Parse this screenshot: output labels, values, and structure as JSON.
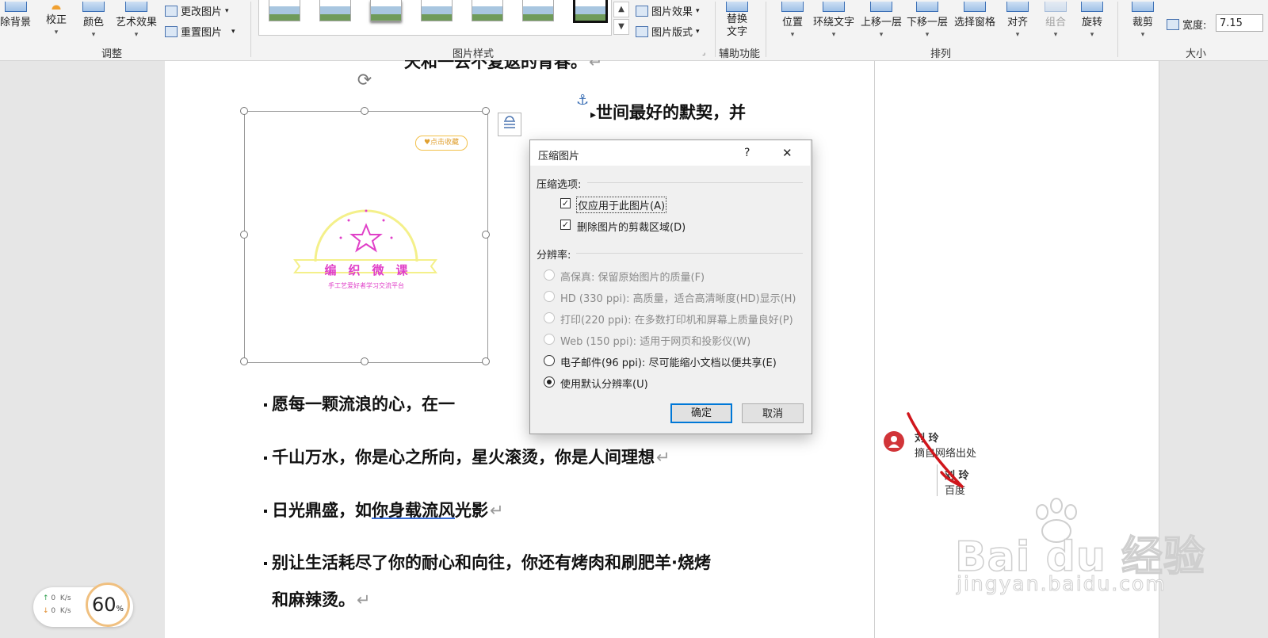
{
  "ribbon": {
    "remove_bg": "除背景",
    "corrections": "校正",
    "color": "颜色",
    "art_effects": "艺术效果",
    "change_picture": "更改图片",
    "reset_picture": "重置图片",
    "group_adjust": "调整",
    "picture_effects": "图片效果",
    "picture_layout": "图片版式",
    "group_styles": "图片样式",
    "alt_text_line1": "替换",
    "alt_text_line2": "文字",
    "group_accessibility": "辅助功能",
    "position": "位置",
    "wrap_text": "环绕文字",
    "bring_forward": "上移一层",
    "send_backward": "下移一层",
    "selection_pane": "选择窗格",
    "align": "对齐",
    "group": "组合",
    "rotate": "旋转",
    "group_arrange": "排列",
    "crop": "裁剪",
    "width_label": "宽度:",
    "width_value": "7.15",
    "group_size": "大小"
  },
  "document": {
    "top_line": "天和一去不复返的青春。",
    "anchored_line": "世间最好的默契，并",
    "lines": [
      "愿每一颗流浪的心，在一",
      "千山万水，你是心之所向，星火滚烫，你是人间理想",
      "日光鼎盛，如你身载流风光影",
      "别让生活耗尽了你的耐心和向往，你还有烤肉和刷肥羊·烧烤",
      "和麻辣烫。"
    ],
    "underlined_fragment": "你身载流风",
    "line3_prefix": "日光鼎盛，如",
    "line3_suffix": "光影",
    "para_mark": "↵"
  },
  "image": {
    "badge": "点击收藏",
    "title": "编　织　微　课",
    "subtitle": "手工艺爱好者学习交流平台"
  },
  "dialog": {
    "title": "压缩图片",
    "help": "?",
    "close": "✕",
    "section_compress": "压缩选项:",
    "opt_apply_only": "仅应用于此图片(A)",
    "opt_delete_cropped": "删除图片的剪裁区域(D)",
    "section_resolution": "分辨率:",
    "res_hifi": "高保真: 保留原始图片的质量(F)",
    "res_hd": "HD (330 ppi): 高质量，适合高清晰度(HD)显示(H)",
    "res_print": "打印(220 ppi): 在多数打印机和屏幕上质量良好(P)",
    "res_web": "Web (150 ppi): 适用于网页和投影仪(W)",
    "res_email": "电子邮件(96 ppi): 尽可能缩小文档以便共享(E)",
    "res_default": "使用默认分辨率(U)",
    "ok": "确定",
    "cancel": "取消"
  },
  "comments": [
    {
      "author": "刘 玲",
      "text": "摘自网络出处"
    },
    {
      "author": "刘 玲",
      "text": "百度"
    }
  ],
  "watermark": {
    "brand": "Bai  du 经验",
    "url": "jingyan.baidu.com"
  },
  "speed_widget": {
    "up": "0",
    "down": "0",
    "unit": "K/s",
    "percent": "60",
    "pct_sign": "%"
  },
  "colors": {
    "accent": "#0078d7",
    "comment_avatar": "#d13438",
    "logo_pink": "#e040c8",
    "logo_yellow": "#f4f08a"
  }
}
